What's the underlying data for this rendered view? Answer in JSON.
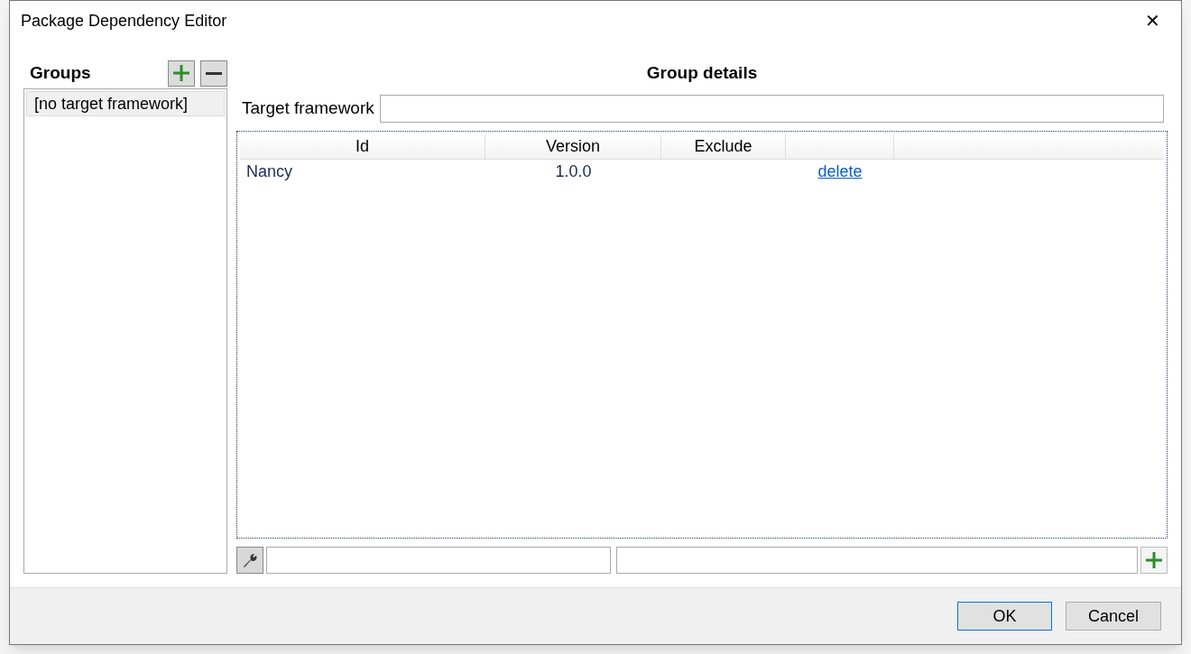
{
  "window": {
    "title": "Package Dependency Editor",
    "close": "✕"
  },
  "groups": {
    "heading": "Groups",
    "items": [
      {
        "label": "[no target framework]",
        "selected": true
      }
    ]
  },
  "details": {
    "heading": "Group details",
    "target_framework_label": "Target framework"
  },
  "table": {
    "columns": [
      "Id",
      "Version",
      "Exclude"
    ],
    "rows": [
      {
        "id": "Nancy",
        "version": "1.0.0",
        "action": "delete"
      }
    ]
  },
  "buttons": [
    {
      "label": "OK",
      "default": true
    },
    {
      "label": "Cancel",
      "default": false
    }
  ]
}
